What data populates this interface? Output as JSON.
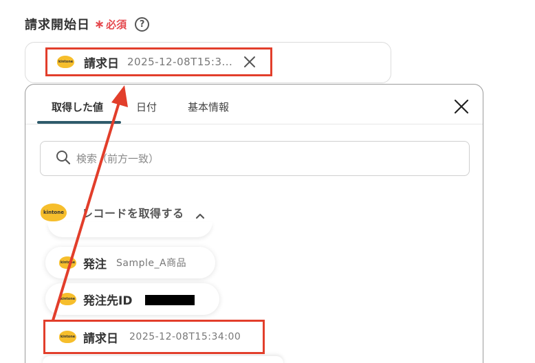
{
  "field": {
    "label": "請求開始日",
    "required_star": "∗",
    "required_text": "必須",
    "help_icon": "?"
  },
  "selected_chip": {
    "app_icon_text": "kintone",
    "key": "請求日",
    "value": "2025-12-08T15:3..."
  },
  "dropdown": {
    "tabs": [
      {
        "label": "取得した値",
        "active": true
      },
      {
        "label": "日付",
        "active": false
      },
      {
        "label": "基本情報",
        "active": false
      }
    ],
    "search_placeholder": "検索（前方一致）",
    "section_title": "レコードを取得する",
    "items": [
      {
        "key": "発注",
        "value": "Sample_A商品"
      },
      {
        "key": "発注先ID",
        "value": "[redacted]"
      },
      {
        "key": "請求日",
        "value": "2025-12-08T15:34:00"
      }
    ]
  },
  "colors": {
    "highlight": "#e23e2b",
    "required": "#e5484d",
    "tab_underline": "#2f5b6b",
    "kintone_yellow": "#f6be2c"
  }
}
